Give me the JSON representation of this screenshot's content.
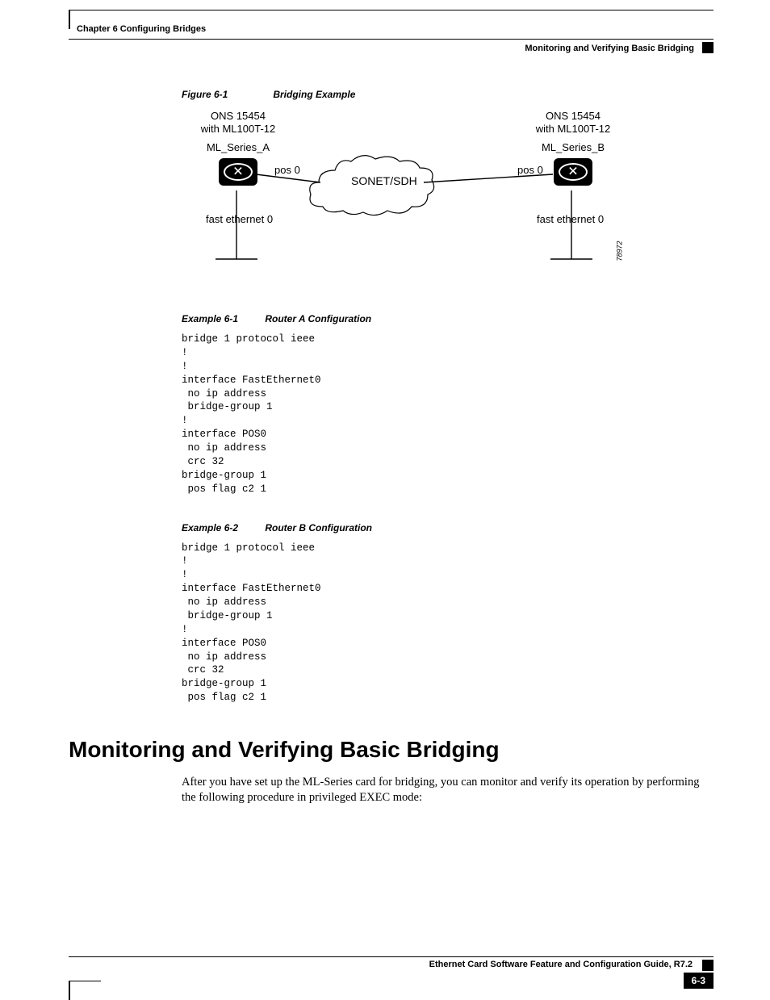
{
  "header": {
    "chapter": "Chapter 6 Configuring Bridges",
    "section": "Monitoring and Verifying Basic Bridging"
  },
  "figure": {
    "label": "Figure 6-1",
    "title": "Bridging Example",
    "left_device_line1": "ONS 15454",
    "left_device_line2": "with ML100T-12",
    "left_name": "ML_Series_A",
    "right_device_line1": "ONS 15454",
    "right_device_line2": "with ML100T-12",
    "right_name": "ML_Series_B",
    "pos_left": "pos 0",
    "pos_right": "pos 0",
    "cloud": "SONET/SDH",
    "fe_left": "fast ethernet 0",
    "fe_right": "fast ethernet 0",
    "id": "78972"
  },
  "example_a": {
    "label": "Example 6-1",
    "title": "Router A Configuration",
    "code": "bridge 1 protocol ieee\n!\n!\ninterface FastEthernet0\n no ip address\n bridge-group 1\n!\ninterface POS0\n no ip address\n crc 32\nbridge-group 1\n pos flag c2 1"
  },
  "example_b": {
    "label": "Example 6-2",
    "title": "Router B Configuration",
    "code": "bridge 1 protocol ieee\n!\n!\ninterface FastEthernet0\n no ip address\n bridge-group 1\n!\ninterface POS0\n no ip address\n crc 32\nbridge-group 1\n pos flag c2 1"
  },
  "section_heading": "Monitoring and Verifying Basic Bridging",
  "section_body": "After you have set up the ML-Series card for bridging, you can monitor and verify its operation by performing the following procedure in privileged EXEC mode:",
  "footer": {
    "book": "Ethernet Card Software Feature and Configuration Guide, R7.2",
    "page": "6-3"
  }
}
